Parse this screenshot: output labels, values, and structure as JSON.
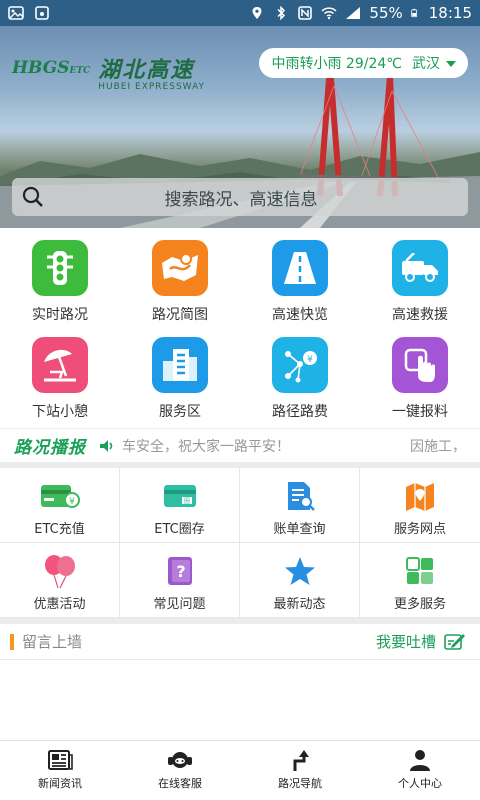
{
  "status_bar": {
    "battery": "55%",
    "time": "18:15"
  },
  "header": {
    "logo_mark": "HBGS",
    "logo_sub": "ETC",
    "logo_cn": "湖北高速",
    "logo_en": "HUBEI EXPRESSWAY",
    "weather": "中雨转小雨 29/24℃",
    "city": "武汉"
  },
  "search": {
    "placeholder": "搜索路况、高速信息"
  },
  "features": [
    {
      "label": "实时路况",
      "icon": "traffic-light-icon",
      "color": "#3dbb3d"
    },
    {
      "label": "路况简图",
      "icon": "road-map-icon",
      "color": "#f5841f"
    },
    {
      "label": "高速快览",
      "icon": "highway-icon",
      "color": "#1e9be8"
    },
    {
      "label": "高速救援",
      "icon": "tow-truck-icon",
      "color": "#1fb2e6"
    },
    {
      "label": "下站小憩",
      "icon": "beach-umbrella-icon",
      "color": "#ef4e7a"
    },
    {
      "label": "服务区",
      "icon": "building-icon",
      "color": "#1e9be8"
    },
    {
      "label": "路径路费",
      "icon": "route-fee-icon",
      "color": "#1fb2e6"
    },
    {
      "label": "一键报料",
      "icon": "tap-hand-icon",
      "color": "#a455d6"
    }
  ],
  "broadcast": {
    "tag": "路况播报",
    "text": "车安全，祝大家一路平安！",
    "text_right": "因施工，"
  },
  "services": [
    {
      "label": "ETC充值",
      "icon": "etc-card-icon"
    },
    {
      "label": "ETC圈存",
      "icon": "etc-transfer-icon"
    },
    {
      "label": "账单查询",
      "icon": "bill-search-icon"
    },
    {
      "label": "服务网点",
      "icon": "map-pin-icon"
    },
    {
      "label": "优惠活动",
      "icon": "balloons-icon"
    },
    {
      "label": "常见问题",
      "icon": "question-book-icon"
    },
    {
      "label": "最新动态",
      "icon": "star-icon"
    },
    {
      "label": "更多服务",
      "icon": "grid-icon"
    }
  ],
  "message_wall": {
    "title": "留言上墙",
    "action": "我要吐槽"
  },
  "bottom_nav": [
    {
      "label": "新闻资讯",
      "icon": "newspaper-icon"
    },
    {
      "label": "在线客服",
      "icon": "headset-icon"
    },
    {
      "label": "路况导航",
      "icon": "navigation-arrow-icon"
    },
    {
      "label": "个人中心",
      "icon": "user-icon"
    }
  ]
}
